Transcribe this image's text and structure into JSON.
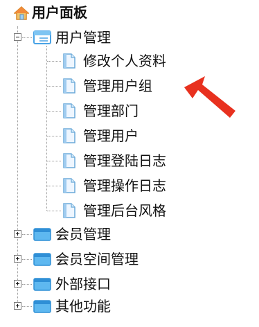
{
  "tree": {
    "root_label": "用户面板",
    "groups": [
      {
        "label": "用户管理",
        "expanded": true,
        "children": [
          "修改个人资料",
          "管理用户组",
          "管理部门",
          "管理用户",
          "管理登陆日志",
          "管理操作日志",
          "管理后台风格"
        ]
      },
      {
        "label": "会员管理",
        "expanded": false
      },
      {
        "label": "会员空间管理",
        "expanded": false
      },
      {
        "label": "外部接口",
        "expanded": false
      },
      {
        "label": "其他功能",
        "expanded": false
      }
    ]
  },
  "annotation": {
    "arrow_color": "#e8311f",
    "points_to": "管理用户组"
  },
  "icons": {
    "root": "home-icon",
    "group": "folder-icon",
    "item": "page-icon"
  }
}
